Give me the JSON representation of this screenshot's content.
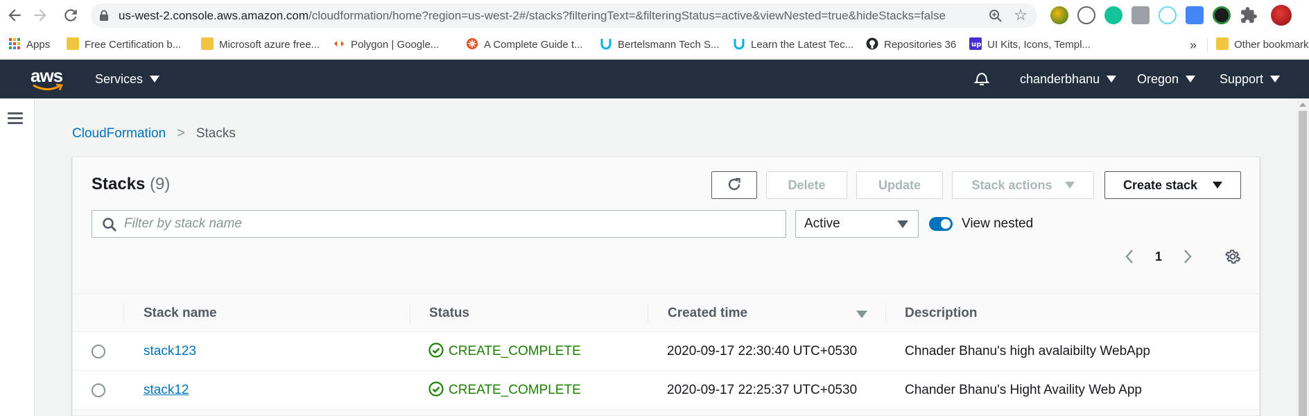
{
  "browser": {
    "url_host": "us-west-2.console.aws.amazon.com",
    "url_path": "/cloudformation/home?region=us-west-2#/stacks?filteringText=&filteringStatus=active&viewNested=true&hideStacks=false",
    "bookmarks": [
      {
        "label": "Apps",
        "icon": "apps-grid-icon"
      },
      {
        "label": "Free Certification b...",
        "icon": "folder-icon"
      },
      {
        "label": "Microsoft azure free...",
        "icon": "folder-icon"
      },
      {
        "label": "Polygon | Google...",
        "icon": "polygon-icon"
      },
      {
        "label": "A Complete Guide t...",
        "icon": "guide-icon"
      },
      {
        "label": "Bertelsmann Tech S...",
        "icon": "udacity-icon"
      },
      {
        "label": "Learn the Latest Tec...",
        "icon": "udacity-icon"
      },
      {
        "label": "Repositories 36",
        "icon": "github-icon"
      },
      {
        "label": "UI Kits, Icons, Templ...",
        "icon": "uplabs-icon"
      }
    ],
    "overflow": "»",
    "other_bookmarks": "Other bookmarks"
  },
  "aws_nav": {
    "logo_text": "aws",
    "services": "Services",
    "account": "chanderbhanu",
    "region": "Oregon",
    "support": "Support"
  },
  "breadcrumb": {
    "root": "CloudFormation",
    "current": "Stacks"
  },
  "stacks_panel": {
    "title": "Stacks",
    "count": "(9)",
    "buttons": {
      "delete": "Delete",
      "update": "Update",
      "stack_actions": "Stack actions",
      "create_stack": "Create stack"
    },
    "search_placeholder": "Filter by stack name",
    "status_filter": "Active",
    "view_nested_label": "View nested",
    "view_nested_on": true,
    "page": "1"
  },
  "table": {
    "columns": [
      "Stack name",
      "Status",
      "Created time",
      "Description"
    ],
    "rows": [
      {
        "name": "stack123",
        "status": "CREATE_COMPLETE",
        "created": "2020-09-17 22:30:40 UTC+0530",
        "description": "Chnader Bhanu's high avalaibilty WebApp"
      },
      {
        "name": "stack12",
        "status": "CREATE_COMPLETE",
        "created": "2020-09-17 22:25:37 UTC+0530",
        "description": "Chander Bhanu's Hight Availity Web App"
      }
    ]
  },
  "colors": {
    "aws_nav_bg": "#232f3e",
    "link": "#0073bb",
    "success": "#1d8102",
    "toggle_on": "#0073bb"
  }
}
